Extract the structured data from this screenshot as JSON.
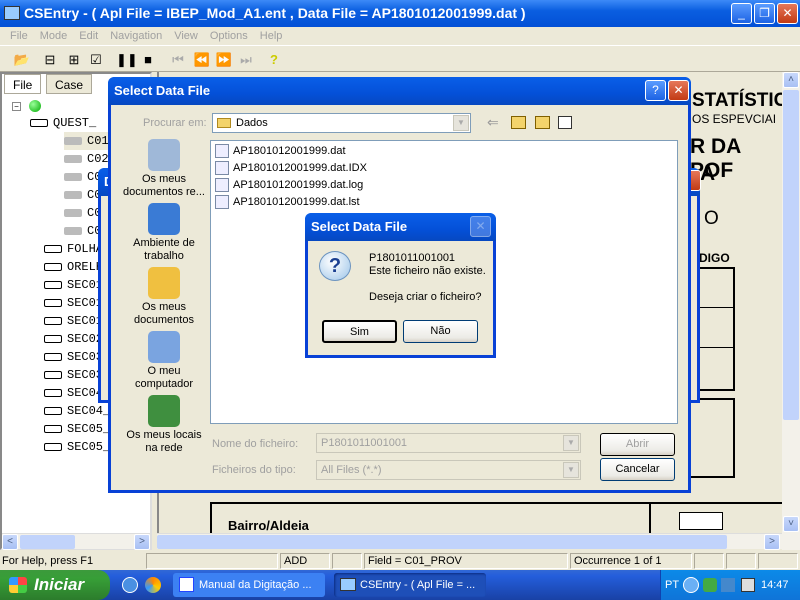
{
  "window": {
    "title": "CSEntry - ( Apl File = IBEP_Mod_A1.ent , Data File = AP1801012001999.dat )",
    "minimize": "_",
    "restore": "❐",
    "close": "✕"
  },
  "menu": [
    "File",
    "Mode",
    "Edit",
    "Navigation",
    "View",
    "Options",
    "Help"
  ],
  "toolbar": {
    "icons": [
      "open-folder-icon",
      "add-case-icon",
      "modify-case-icon",
      "verify-case-icon",
      "pause-icon",
      "stop-icon",
      "first-icon",
      "previous-icon",
      "next-icon",
      "last-icon",
      "help-icon"
    ],
    "glyphs": [
      "📂",
      "⊟",
      "⊞",
      "☑",
      "❚❚",
      "■",
      "⏮",
      "⏪",
      "⏩",
      "⏭",
      "?"
    ]
  },
  "left_pane": {
    "tabs": [
      "File",
      "Case"
    ],
    "tree": [
      {
        "label": "QUEST_",
        "level": 1,
        "type": "record"
      },
      {
        "label": "C01_",
        "level": 2,
        "type": "field"
      },
      {
        "label": "C02_",
        "level": 2,
        "type": "field"
      },
      {
        "label": "C0",
        "level": 2,
        "type": "field"
      },
      {
        "label": "C0",
        "level": 2,
        "type": "field"
      },
      {
        "label": "C0",
        "level": 2,
        "type": "field"
      },
      {
        "label": "C0",
        "level": 2,
        "type": "field"
      },
      {
        "label": "FOLHA",
        "level": 1,
        "type": "record"
      },
      {
        "label": "ORELH",
        "level": 1,
        "type": "record"
      },
      {
        "label": "SEC01",
        "level": 1,
        "type": "record"
      },
      {
        "label": "SEC01",
        "level": 1,
        "type": "record"
      },
      {
        "label": "SEC01",
        "level": 1,
        "type": "record"
      },
      {
        "label": "SEC02",
        "level": 1,
        "type": "record"
      },
      {
        "label": "SEC03",
        "level": 1,
        "type": "record"
      },
      {
        "label": "SEC03",
        "level": 1,
        "type": "record"
      },
      {
        "label": "SEC04",
        "level": 1,
        "type": "record"
      },
      {
        "label": "SEC04_",
        "level": 1,
        "type": "record"
      },
      {
        "label": "SEC05_",
        "level": 1,
        "type": "record"
      },
      {
        "label": "SEC05_",
        "level": 1,
        "type": "record"
      }
    ]
  },
  "form": {
    "heading1": "STATÍSTIC",
    "heading2": "OS ESPEVCIAI",
    "heading3": "R DA POF",
    "heading4": "A",
    "heading5": "O",
    "heading6": "DIGO",
    "bairro": "Bairro/Aldeia"
  },
  "behind_dialog": {
    "title_fragment": "D"
  },
  "file_dialog": {
    "title": "Select Data File",
    "help": "?",
    "close": "✕",
    "look_in_label": "Procurar em:",
    "look_in_value": "Dados",
    "places": [
      {
        "label": "Os meus documentos re...",
        "icon": "recent-documents-icon",
        "color": "#9fb8d8"
      },
      {
        "label": "Ambiente de trabalho",
        "icon": "desktop-icon",
        "color": "#3a7bd5"
      },
      {
        "label": "Os meus documentos",
        "icon": "my-documents-icon",
        "color": "#f0c040"
      },
      {
        "label": "O meu computador",
        "icon": "my-computer-icon",
        "color": "#7aa4e0"
      },
      {
        "label": "Os meus locais na rede",
        "icon": "network-places-icon",
        "color": "#3f8f3f"
      }
    ],
    "files": [
      "AP1801012001999.dat",
      "AP1801012001999.dat.IDX",
      "AP1801012001999.dat.log",
      "AP1801012001999.dat.lst"
    ],
    "filename_label": "Nome do ficheiro:",
    "filename_value": "P1801011001001",
    "filetype_label": "Ficheiros do tipo:",
    "filetype_value": "All Files (*.*)",
    "open_button": "Abrir",
    "cancel_button": "Cancelar"
  },
  "message_box": {
    "title": "Select Data File",
    "close": "✕",
    "line1": "P1801011001001",
    "line2": "Este ficheiro não existe.",
    "line3": "Deseja criar o ficheiro?",
    "yes": "Sim",
    "no": "Não"
  },
  "status": {
    "help": "For Help, press F1",
    "mode": "ADD",
    "field": "Field = C01_PROV",
    "occurrence": "Occurrence 1 of 1"
  },
  "taskbar": {
    "start": "Iniciar",
    "tasks": [
      "Manual da Digitação ...",
      "CSEntry - ( Apl File = ..."
    ],
    "lang": "PT",
    "clock": "14:47"
  }
}
